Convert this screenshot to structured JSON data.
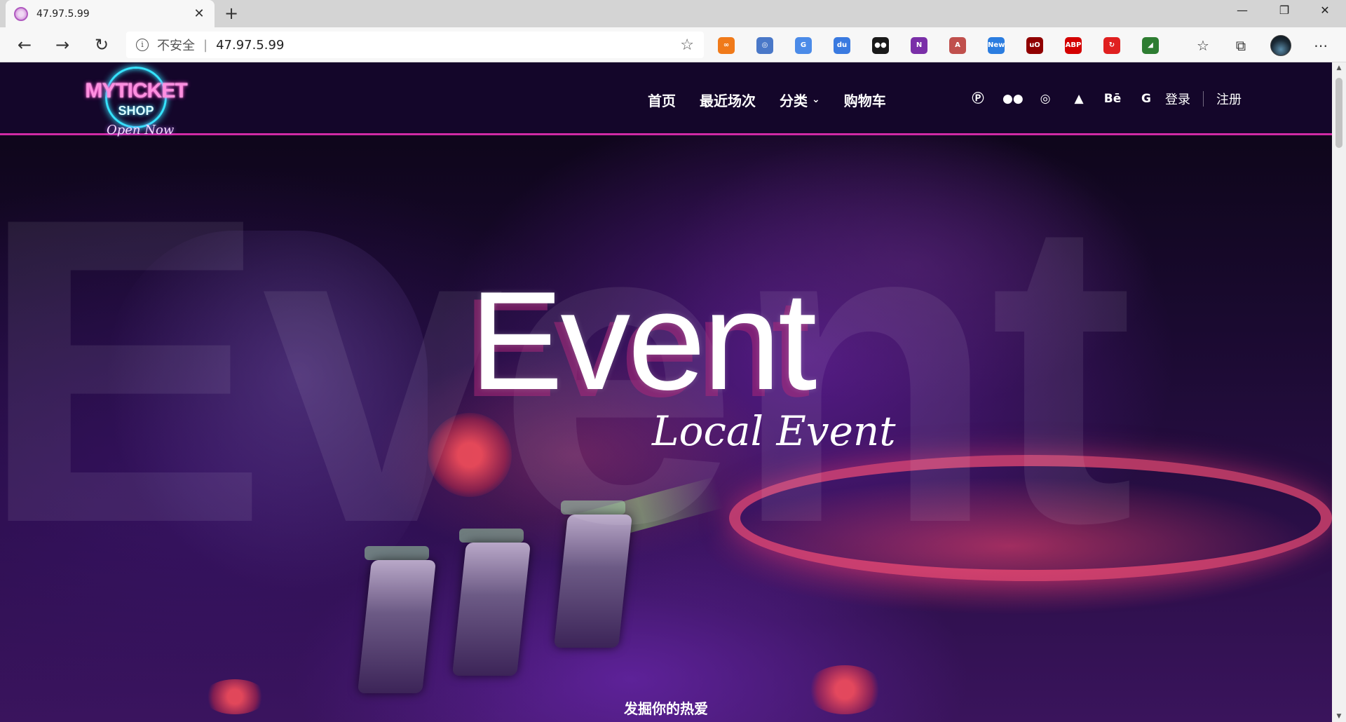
{
  "browser": {
    "tab_title": "47.97.5.99",
    "new_tab_symbol": "+",
    "close_symbol": "✕",
    "window_controls": {
      "minimize": "—",
      "restore": "❐",
      "close": "✕"
    },
    "address": {
      "security_label": "不安全",
      "separator": "|",
      "url": "47.97.5.99"
    },
    "extensions": [
      {
        "name": "infinity-extension",
        "label": "∞",
        "color": "#f07a1a"
      },
      {
        "name": "reader-extension",
        "label": "◎",
        "color": "#4a78c8"
      },
      {
        "name": "translate-extension",
        "label": "G",
        "color": "#4b8be8"
      },
      {
        "name": "du-extension",
        "label": "du",
        "color": "#3a7ae0"
      },
      {
        "name": "tampermonkey-extension",
        "label": "●●",
        "color": "#1a1a1a"
      },
      {
        "name": "onenote-extension",
        "label": "N",
        "color": "#7a2fa8"
      },
      {
        "name": "pdf-extension",
        "label": "A",
        "color": "#c0504d"
      },
      {
        "name": "new-extension",
        "label": "New",
        "color": "#2b7de0"
      },
      {
        "name": "ublock-extension",
        "label": "uO",
        "color": "#900000"
      },
      {
        "name": "adblock-plus-extension",
        "label": "ABP",
        "color": "#d40000"
      },
      {
        "name": "refresh-extension",
        "label": "↻",
        "color": "#e02020"
      },
      {
        "name": "sheets-extension",
        "label": "◢",
        "color": "#2e7d32"
      }
    ]
  },
  "site": {
    "logo": {
      "top": "MYTICKET",
      "middle": "SHOP",
      "bottom": "Open Now"
    },
    "nav": {
      "home": "首页",
      "recent": "最近场次",
      "category": "分类",
      "cart": "购物车"
    },
    "social": [
      "pinterest-icon",
      "wechat-icon",
      "weibo-icon",
      "adobe-icon",
      "behance-icon",
      "google-icon"
    ],
    "social_labels": {
      "behance": "Bē",
      "google": "G"
    },
    "auth": {
      "login": "登录",
      "register": "注册"
    },
    "hero": {
      "background_word": "Event",
      "title": "Event",
      "subtitle": "Local Event",
      "tagline": "发掘你的热爱"
    }
  },
  "colors": {
    "header_bg": "#14062a",
    "header_border": "#d02aa5",
    "neon_pink": "#ff39c8",
    "neon_cyan": "#35e3ff"
  }
}
